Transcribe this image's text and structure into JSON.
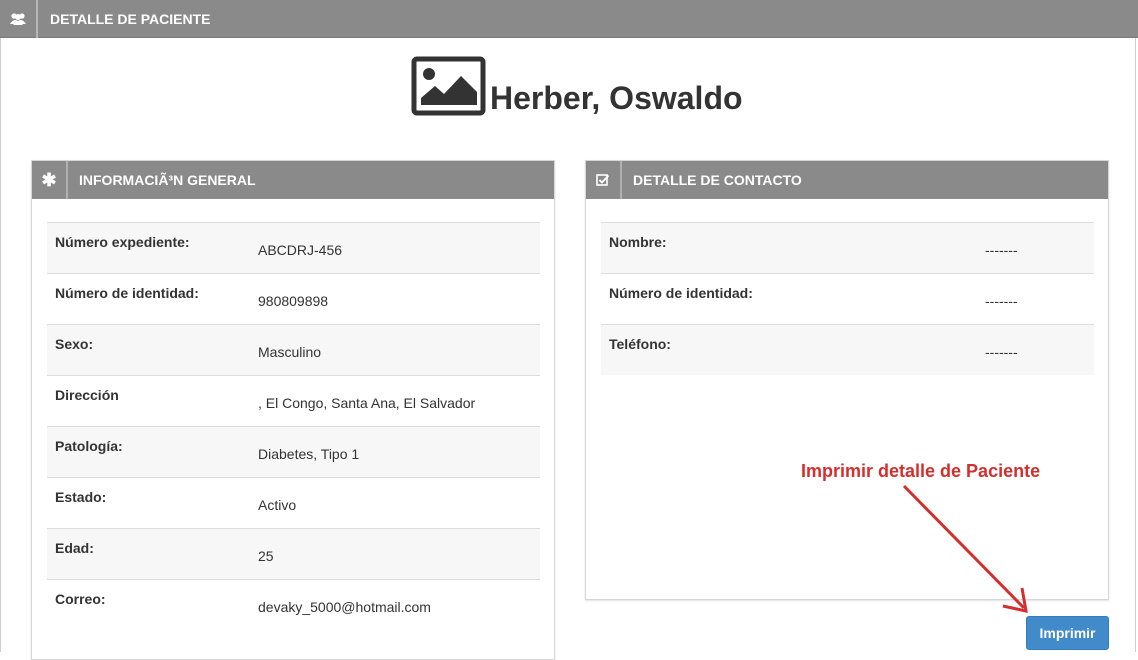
{
  "header": {
    "title": "DETALLE DE PACIENTE",
    "icon": "users-icon"
  },
  "patient": {
    "name": "Herber, Oswaldo",
    "avatar_icon": "image-placeholder-icon"
  },
  "general": {
    "title": "INFORMACIÃ³N GENERAL",
    "icon": "asterisk-icon",
    "rows": [
      {
        "label": "Número expediente:",
        "value": "ABCDRJ-456"
      },
      {
        "label": "Número de identidad:",
        "value": "980809898"
      },
      {
        "label": "Sexo:",
        "value": "Masculino"
      },
      {
        "label": "Dirección",
        "value": ", El Congo, Santa Ana, El Salvador"
      },
      {
        "label": "Patología:",
        "value": "Diabetes, Tipo 1"
      },
      {
        "label": "Estado:",
        "value": "Activo"
      },
      {
        "label": "Edad:",
        "value": "25"
      },
      {
        "label": "Correo:",
        "value": "devaky_5000@hotmail.com"
      }
    ]
  },
  "contact": {
    "title": "DETALLE DE CONTACTO",
    "icon": "checkbox-icon",
    "rows": [
      {
        "label": "Nombre:",
        "value": "-------"
      },
      {
        "label": "Número de identidad:",
        "value": "-------"
      },
      {
        "label": "Teléfono:",
        "value": "-------"
      }
    ]
  },
  "annotation": {
    "text": "Imprimir detalle de Paciente",
    "color": "#d32f2f"
  },
  "actions": {
    "print_label": "Imprimir"
  },
  "colors": {
    "header_bg": "#8a8a8a",
    "button_bg": "#428bca"
  }
}
